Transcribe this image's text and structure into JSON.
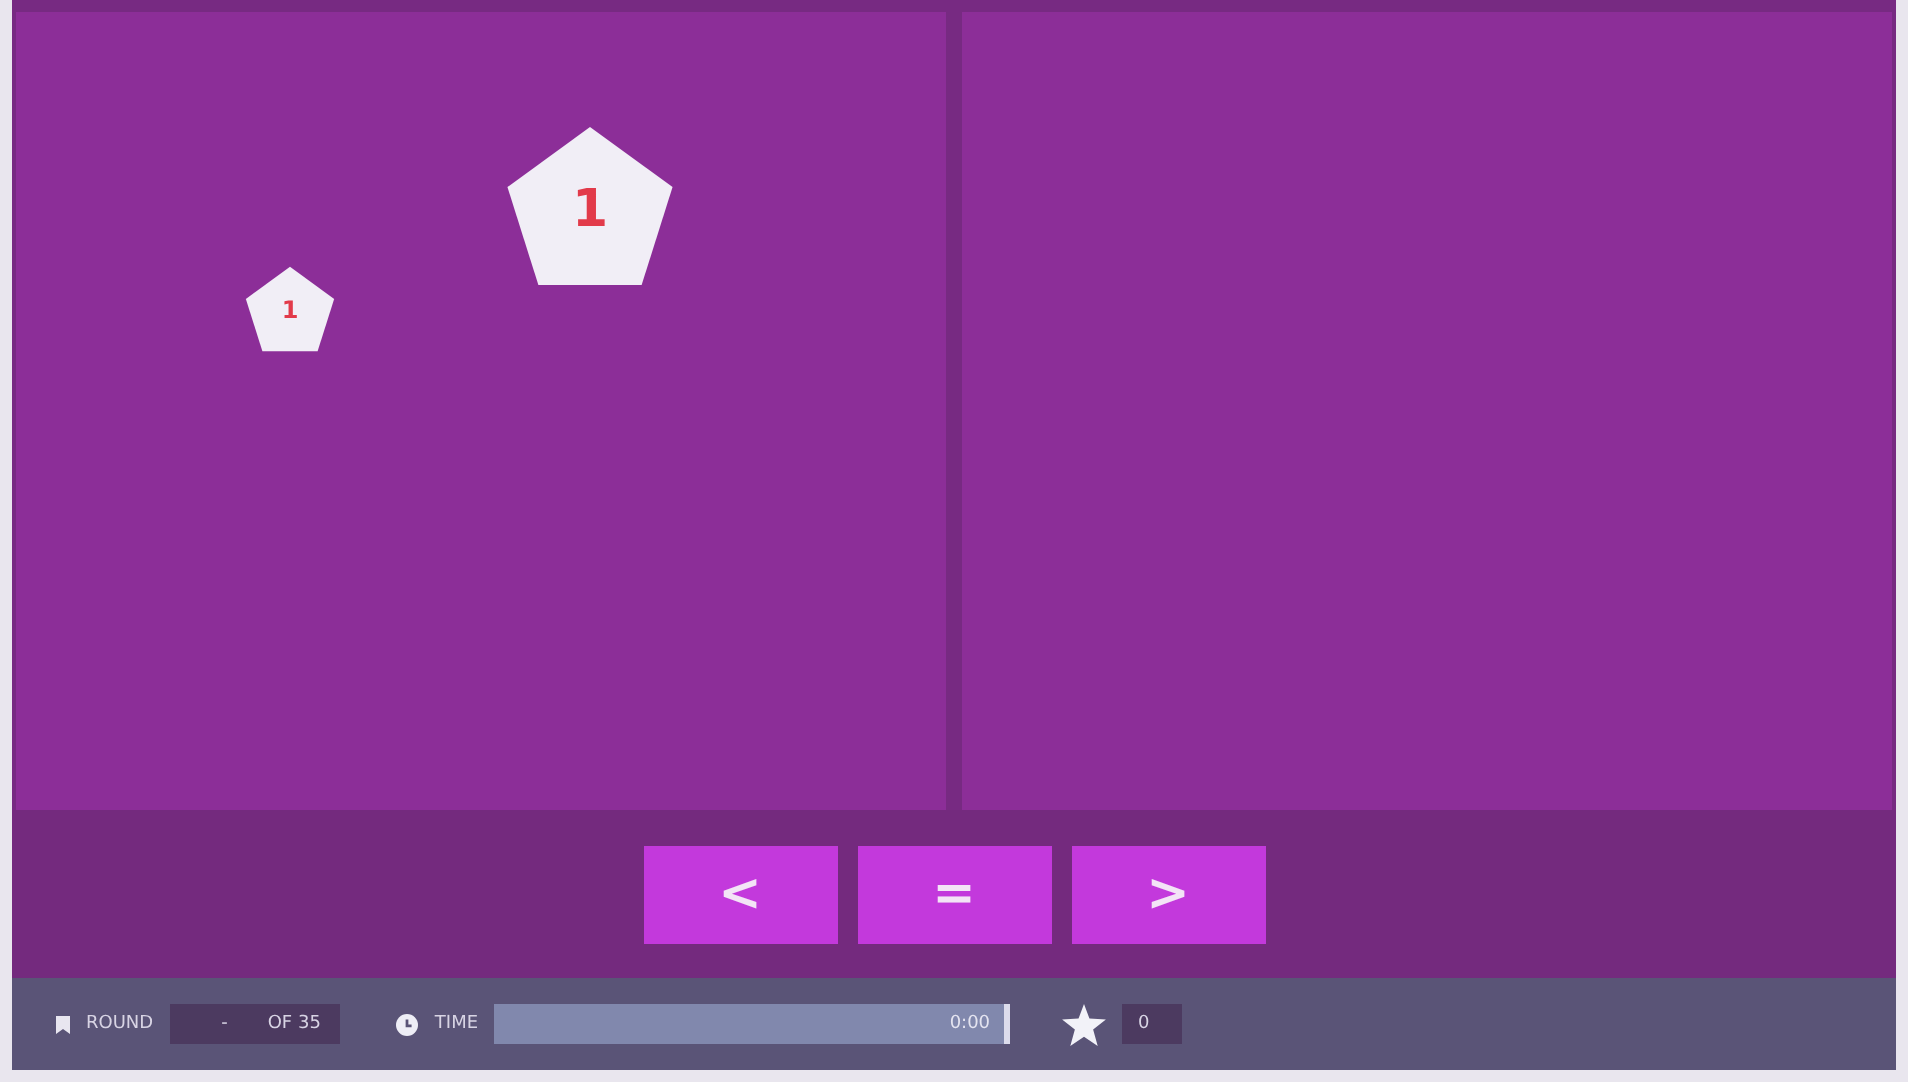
{
  "shapes": [
    {
      "label": "1",
      "kind": "large"
    },
    {
      "label": "1",
      "kind": "small"
    }
  ],
  "buttons": [
    "<",
    "=",
    ">"
  ],
  "status_bar": {
    "round_label": "ROUND",
    "round_value": "-",
    "round_total": "OF 35",
    "time_label": "TIME",
    "time": {
      "level": 1,
      "reading": "0:00"
    },
    "score": "0"
  }
}
